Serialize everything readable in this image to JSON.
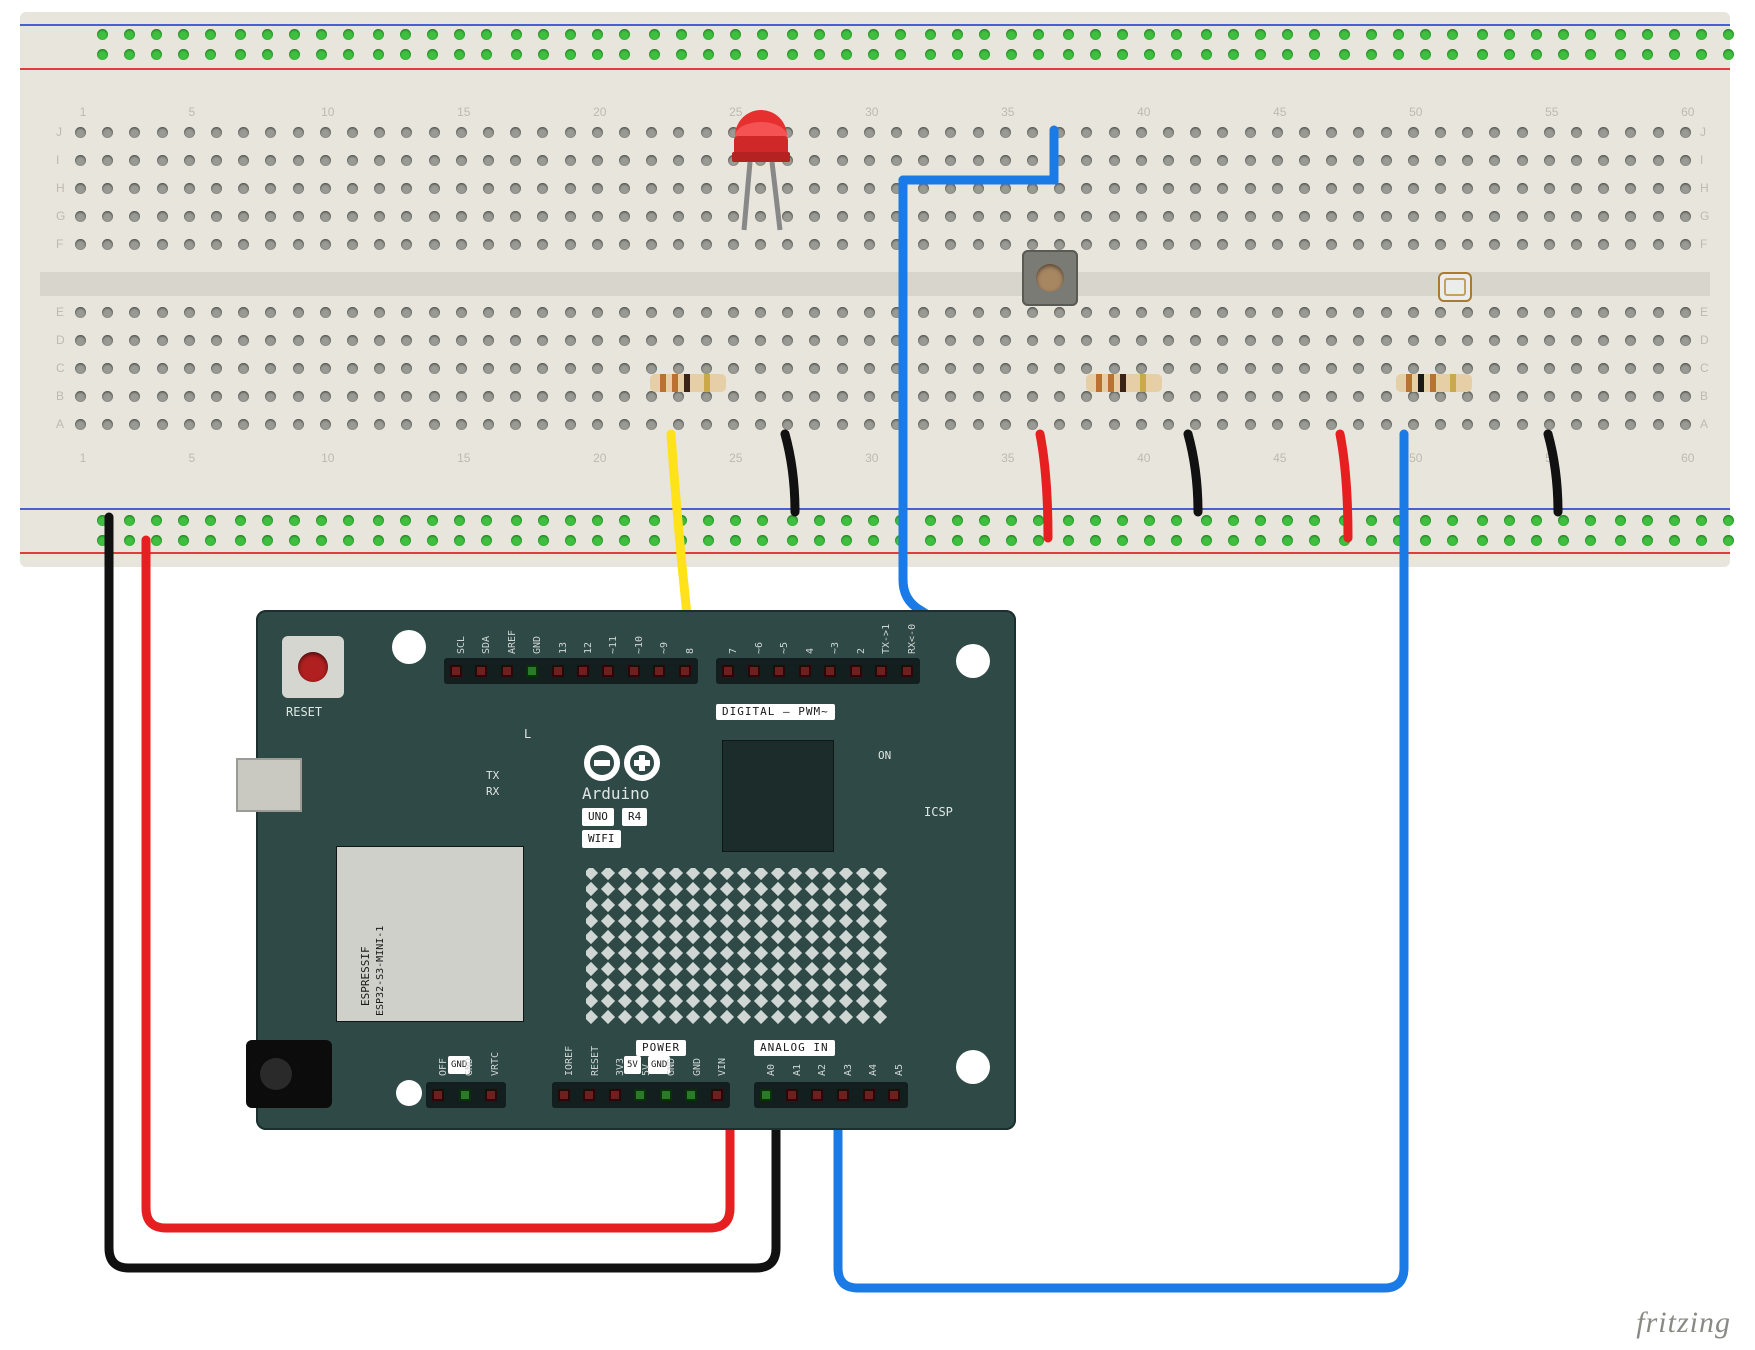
{
  "domain": "Diagram",
  "watermark": "fritzing",
  "breadboard": {
    "col_numbers": [
      "1",
      "5",
      "10",
      "15",
      "20",
      "25",
      "30",
      "35",
      "40",
      "45",
      "50",
      "55",
      "60"
    ],
    "row_labels_top": [
      "J",
      "I",
      "H",
      "G",
      "F"
    ],
    "row_labels_bottom": [
      "E",
      "D",
      "C",
      "B",
      "A"
    ]
  },
  "arduino": {
    "reset_label": "RESET",
    "logo_text": "Arduino",
    "model_box_1": "UNO",
    "model_box_2": "R4",
    "model_box_3": "WIFI",
    "digital_strip": "DIGITAL – PWM~",
    "power_strip": "POWER",
    "analog_strip": "ANALOG IN",
    "on_label": "ON",
    "icsp_label": "ICSP",
    "tx_label": "TX",
    "rx_label": "RX",
    "l_label": "L",
    "espressif_line1": "ESPRESSIF",
    "espressif_line2": "ESP32-S3-MINI-1",
    "top_pins_left": [
      "SCL",
      "SDA",
      "AREF",
      "GND",
      "13",
      "12",
      "~11",
      "~10",
      "~9",
      "8"
    ],
    "top_pins_right": [
      "7",
      "~6",
      "~5",
      "4",
      "~3",
      "2",
      "TX->1",
      "RX<-0"
    ],
    "power_pins_left": [
      "OFF",
      "GND",
      "VRTC"
    ],
    "power_pins_mid": [
      "IOREF",
      "RESET",
      "3V3",
      "5V",
      "GND",
      "GND",
      "VIN"
    ],
    "analog_pins": [
      "A0",
      "A1",
      "A2",
      "A3",
      "A4",
      "A5"
    ],
    "boxed_pins": {
      "power_gnd": "GND",
      "mid_5v": "5V",
      "mid_gnd": "GND"
    }
  },
  "components": {
    "led": {
      "name": "led-red",
      "color": "#e63030"
    },
    "pushbutton": {
      "name": "pushbutton"
    },
    "ldr": {
      "name": "photoresistor"
    },
    "resistors": [
      {
        "name": "resistor-led",
        "bands": [
          "#b07030",
          "#b07030",
          "#402010",
          "#caa94a"
        ]
      },
      {
        "name": "resistor-button",
        "bands": [
          "#b07030",
          "#b07030",
          "#402010",
          "#caa94a"
        ]
      },
      {
        "name": "resistor-ldr",
        "bands": [
          "#b07030",
          "#1a1a1a",
          "#b07030",
          "#caa94a"
        ]
      }
    ]
  },
  "wires": [
    {
      "name": "wire-gnd-rail",
      "color": "black"
    },
    {
      "name": "wire-5v-rail",
      "color": "red"
    },
    {
      "name": "wire-d2-button",
      "color": "blue"
    },
    {
      "name": "wire-d9-led",
      "color": "yellow"
    },
    {
      "name": "wire-a0-ldr",
      "color": "blue"
    },
    {
      "name": "short-black-1",
      "color": "black"
    },
    {
      "name": "short-black-2",
      "color": "black"
    },
    {
      "name": "short-black-3",
      "color": "black"
    },
    {
      "name": "short-black-4",
      "color": "black"
    },
    {
      "name": "short-red-1",
      "color": "red"
    },
    {
      "name": "short-red-2",
      "color": "red"
    }
  ]
}
